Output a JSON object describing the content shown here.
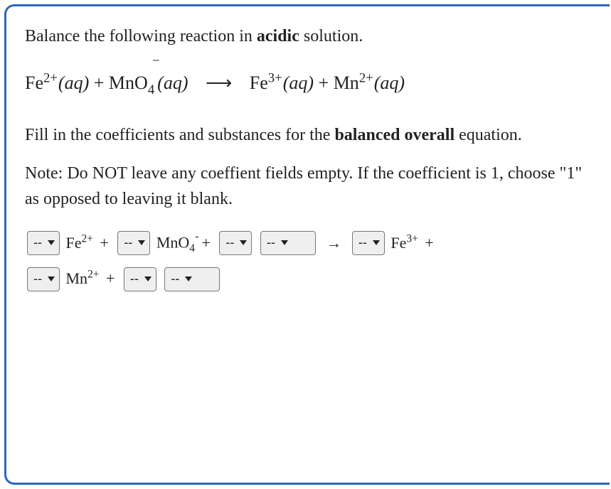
{
  "prompt": {
    "prefix": "Balance the following reaction in ",
    "acidic": "acidic",
    "suffix": " solution."
  },
  "equation": {
    "fe2": "Fe",
    "fe2_charge": "2+",
    "aq": "(aq)",
    "plus": " + ",
    "mno4_base": "MnO",
    "mno4_sub": "4",
    "mno4_sup": "−",
    "arrow": "⟶",
    "fe3": "Fe",
    "fe3_charge": "3+",
    "mn2": "Mn",
    "mn2_charge": "2+"
  },
  "instr1_prefix": "Fill in the coefficients and substances for the ",
  "instr1_bold": "balanced overall",
  "instr1_suffix": " equation.",
  "note": "Note: Do NOT leave any coeffient fields empty. If the coefficient is 1, choose \"1\" as opposed to leaving it blank.",
  "selects": {
    "dash": "--"
  },
  "species": {
    "fe2_base": "Fe",
    "fe2_sup": "2+",
    "mno4_base": "MnO",
    "mno4_sub": "4",
    "mno4_sup": "-",
    "fe3_base": "Fe",
    "fe3_sup": "3+",
    "mn2_base": "Mn",
    "mn2_sup": "2+",
    "plus": "+",
    "arrow": "→"
  }
}
